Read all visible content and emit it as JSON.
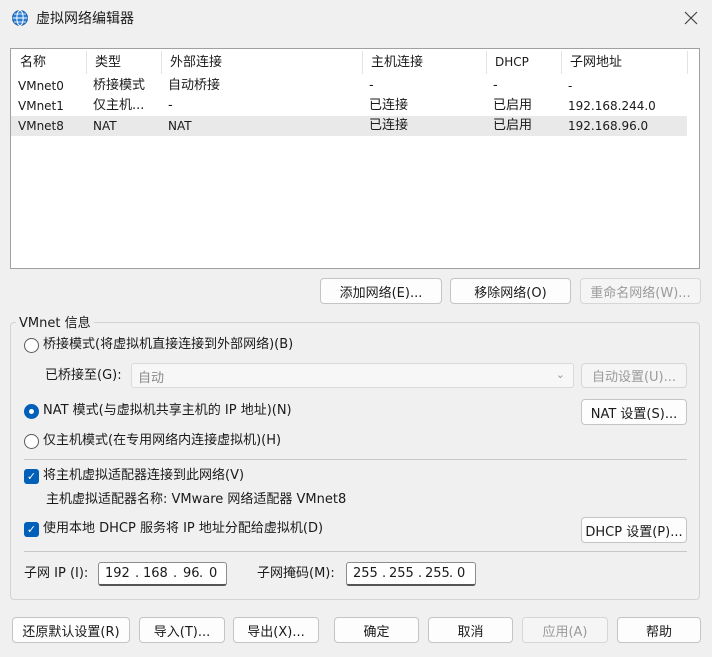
{
  "window": {
    "title": "虚拟网络编辑器"
  },
  "table": {
    "columns": [
      "名称",
      "类型",
      "外部连接",
      "主机连接",
      "DHCP",
      "子网地址"
    ],
    "rows": [
      [
        "VMnet0",
        "桥接模式",
        "自动桥接",
        "-",
        "-",
        "-"
      ],
      [
        "VMnet1",
        "仅主机...",
        "-",
        "已连接",
        "已启用",
        "192.168.244.0"
      ],
      [
        "VMnet8",
        "NAT",
        "NAT",
        "已连接",
        "已启用",
        "192.168.96.0"
      ]
    ],
    "selected_row": 2
  },
  "list_buttons": {
    "add": "添加网络(E)...",
    "remove": "移除网络(O)",
    "rename": "重命名网络(W)..."
  },
  "vmnet_info": {
    "group_label": "VMnet 信息",
    "bridged_label": "桥接模式(将虚拟机直接连接到外部网络)(B)",
    "bridged_to_label": "已桥接至(G):",
    "bridged_to_value": "自动",
    "auto_settings": "自动设置(U)...",
    "nat_label": "NAT 模式(与虚拟机共享主机的 IP 地址)(N)",
    "nat_settings": "NAT 设置(S)...",
    "hostonly_label": "仅主机模式(在专用网络内连接虚拟机)(H)",
    "selected_mode": "nat",
    "connect_adapter_label": "将主机虚拟适配器连接到此网络(V)",
    "connect_adapter_checked": true,
    "adapter_name_text": "主机虚拟适配器名称: VMware 网络适配器 VMnet8",
    "dhcp_label": "使用本地 DHCP 服务将 IP 地址分配给虚拟机(D)",
    "dhcp_checked": true,
    "dhcp_settings": "DHCP 设置(P)...",
    "subnet_ip_label": "子网 IP (I):",
    "subnet_ip": [
      "192",
      "168",
      "96",
      "0"
    ],
    "subnet_mask_label": "子网掩码(M):",
    "subnet_mask": [
      "255",
      "255",
      "255",
      "0"
    ]
  },
  "footer_buttons": {
    "restore": "还原默认设置(R)",
    "import": "导入(T)...",
    "export": "导出(X)...",
    "ok": "确定",
    "cancel": "取消",
    "apply": "应用(A)",
    "help": "帮助"
  },
  "colors": {
    "accent": "#005fb8",
    "background": "#f0f0f0",
    "selected_row": "#e9e9e9"
  },
  "icons": {
    "app": "globe-network-icon",
    "close": "close-icon",
    "dropdown": "chevron-down-icon"
  }
}
